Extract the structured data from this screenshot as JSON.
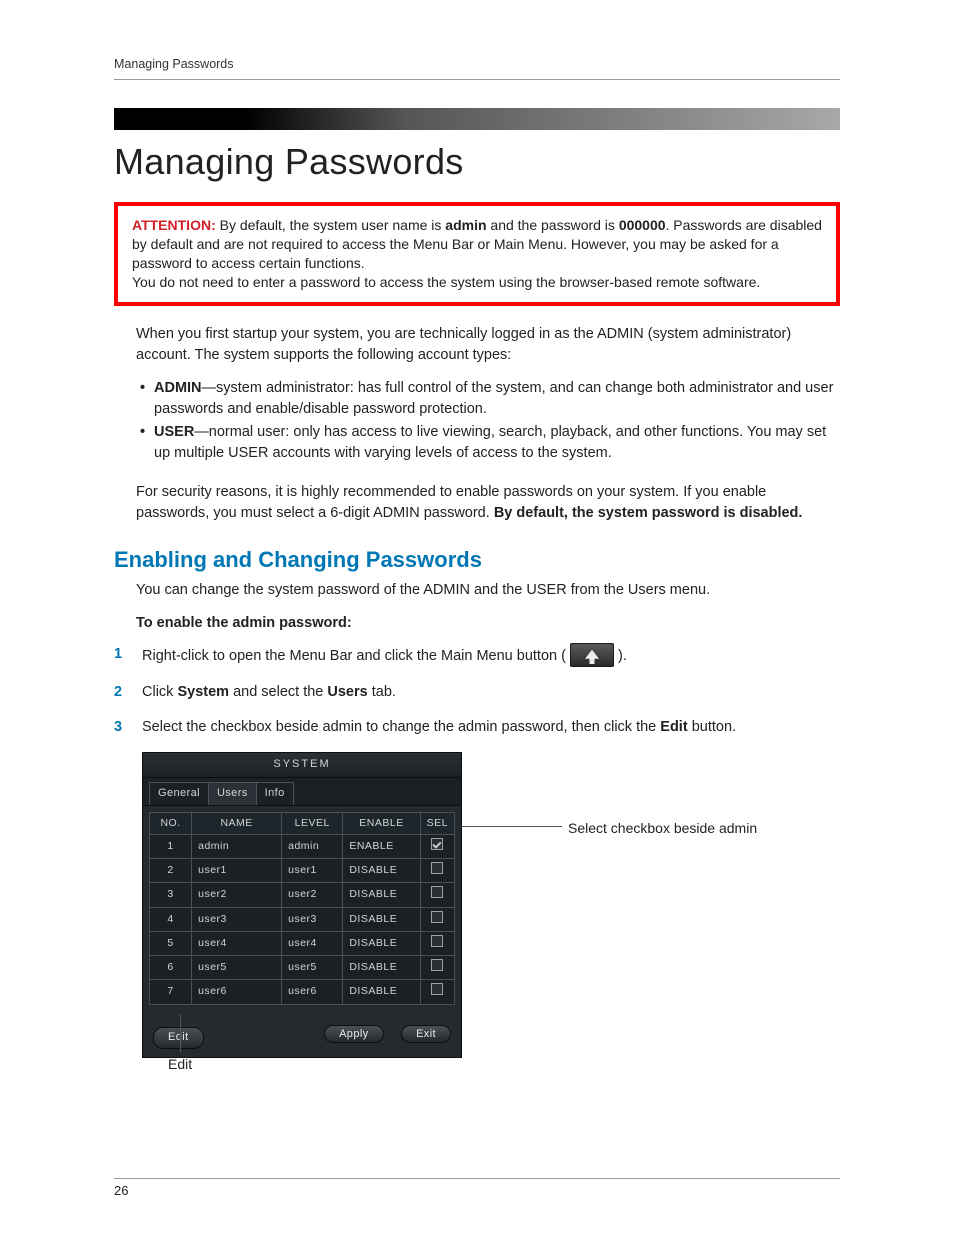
{
  "header": {
    "running": "Managing Passwords"
  },
  "title": "Managing Passwords",
  "attention": {
    "label": "ATTENTION:",
    "text1a": " By default, the system user name is ",
    "admin": "admin",
    "text1b": " and the password is ",
    "pwd": "000000",
    "text1c": ". Passwords are disabled by default and are not required to access the Menu Bar or Main Menu. However, you may be asked for a password to access certain functions.",
    "text2": "You do not need to enter a password to access the system using the browser-based remote software."
  },
  "intro": "When you first startup your system, you are technically logged in as the ADMIN (system administrator) account. The system supports the following account types:",
  "accounts": [
    {
      "name": "ADMIN",
      "desc": "—system administrator: has full control of the system, and can change both administrator and user passwords and enable/disable password protection."
    },
    {
      "name": "USER",
      "desc": "—normal user: only has access to live viewing, search, playback, and other functions. You may set up multiple USER accounts with varying levels of access to the system."
    }
  ],
  "security_a": "For security reasons, it is highly recommended to enable passwords on your system. If you enable passwords, you must select a 6-digit ADMIN password. ",
  "security_b": "By default, the system password is disabled.",
  "h2": "Enabling and Changing Passwords",
  "h2_sub": "You can change the system password of the ADMIN and the USER from the Users menu.",
  "procedure_heading": "To enable the admin password:",
  "steps": {
    "s1a": "Right-click to open the Menu Bar and click the Main Menu button ( ",
    "s1b": " ).",
    "s2a": "Click ",
    "s2b": "System",
    "s2c": " and select the ",
    "s2d": "Users",
    "s2e": " tab.",
    "s3a": "Select the checkbox beside admin to change the admin password, then click the ",
    "s3b": "Edit",
    "s3c": " button."
  },
  "system_window": {
    "title": "SYSTEM",
    "tabs": [
      "General",
      "Users",
      "Info"
    ],
    "active_tab_index": 1,
    "columns": [
      "NO.",
      "NAME",
      "LEVEL",
      "ENABLE",
      "SEL"
    ],
    "rows": [
      {
        "no": "1",
        "name": "admin",
        "level": "admin",
        "enable": "ENABLE",
        "sel": true
      },
      {
        "no": "2",
        "name": "user1",
        "level": "user1",
        "enable": "DISABLE",
        "sel": false
      },
      {
        "no": "3",
        "name": "user2",
        "level": "user2",
        "enable": "DISABLE",
        "sel": false
      },
      {
        "no": "4",
        "name": "user3",
        "level": "user3",
        "enable": "DISABLE",
        "sel": false
      },
      {
        "no": "5",
        "name": "user4",
        "level": "user4",
        "enable": "DISABLE",
        "sel": false
      },
      {
        "no": "6",
        "name": "user5",
        "level": "user5",
        "enable": "DISABLE",
        "sel": false
      },
      {
        "no": "7",
        "name": "user6",
        "level": "user6",
        "enable": "DISABLE",
        "sel": false
      }
    ],
    "buttons": {
      "edit": "Edit",
      "apply": "Apply",
      "exit": "Exit"
    }
  },
  "callouts": {
    "checkbox": "Select checkbox beside admin",
    "edit": "Edit"
  },
  "page_number": "26"
}
